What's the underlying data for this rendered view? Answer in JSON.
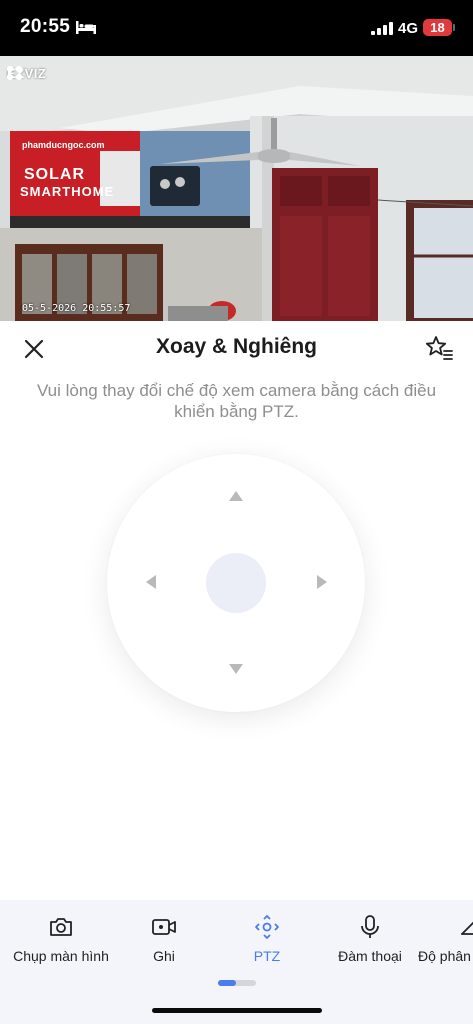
{
  "status_bar": {
    "time": "20:55",
    "network": "4G",
    "battery": "18"
  },
  "camera": {
    "brand": "EZVIZ",
    "osd_timestamp": "05-5-2026 20:55:57",
    "sign_url": "phamducngoc.com",
    "sign_line1": "SOLAR",
    "sign_line2": "SMARTHOME"
  },
  "header": {
    "title": "Xoay & Nghiêng"
  },
  "hint": "Vui lòng thay đổi chế độ xem camera bằng cách điều khiển bằng PTZ.",
  "toolbar": {
    "items": [
      {
        "label": "Chụp màn hình",
        "icon": "camera-icon"
      },
      {
        "label": "Ghi",
        "icon": "video-record-icon"
      },
      {
        "label": "PTZ",
        "icon": "ptz-icon",
        "active": true
      },
      {
        "label": "Đàm thoại",
        "icon": "microphone-icon"
      },
      {
        "label": "Độ phân giải",
        "icon": "resolution-icon"
      }
    ]
  },
  "colors": {
    "accent": "#4a7cf0",
    "knob": "#ebedf7",
    "toolbar_bg": "#f3f5fb",
    "battery_low": "#e03a3e"
  }
}
